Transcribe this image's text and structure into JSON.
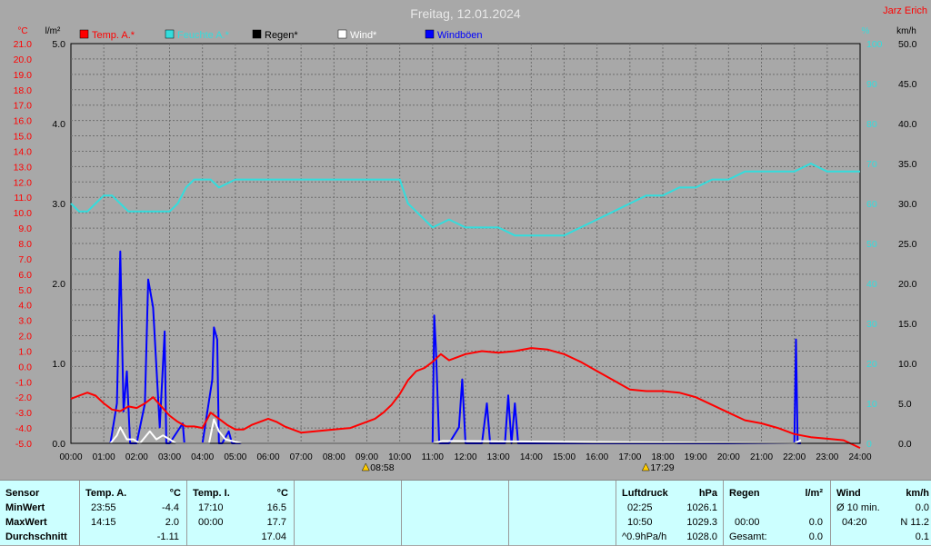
{
  "header": {
    "title": "Freitag, 12.01.2024",
    "author": "Jarz Erich"
  },
  "colors": {
    "temp": "#ff0000",
    "humidity": "#33dddd",
    "rain": "#000000",
    "wind": "#ffffff",
    "gust": "#0000ff",
    "grid": "#6e6e6e",
    "left_text": "#ff0000",
    "hum_text": "#33dddd"
  },
  "chart_data": {
    "type": "line",
    "title": "Freitag, 12.01.2024",
    "x_axis": {
      "start_hour": 0,
      "end_hour": 24,
      "tick_labels": [
        "00:00",
        "01:00",
        "02:00",
        "03:00",
        "04:00",
        "05:00",
        "06:00",
        "07:00",
        "08:00",
        "09:00",
        "10:00",
        "11:00",
        "12:00",
        "13:00",
        "14:00",
        "15:00",
        "16:00",
        "17:00",
        "18:00",
        "19:00",
        "20:00",
        "21:00",
        "22:00",
        "23:00",
        "24:00"
      ]
    },
    "axes": {
      "temp": {
        "unit": "°C",
        "min": -5.0,
        "max": 21.0,
        "ticks": [
          "21.0",
          "20.0",
          "19.0",
          "18.0",
          "17.0",
          "16.0",
          "15.0",
          "14.0",
          "13.0",
          "12.0",
          "11.0",
          "10.0",
          "9.0",
          "8.0",
          "7.0",
          "6.0",
          "5.0",
          "4.0",
          "3.0",
          "2.0",
          "1.0",
          "0.0",
          "-1.0",
          "-2.0",
          "-3.0",
          "-4.0",
          "-5.0"
        ]
      },
      "rain": {
        "unit": "l/m²",
        "min": 0,
        "max": 5,
        "ticks": [
          "5.0",
          "4.0",
          "3.0",
          "2.0",
          "1.0",
          "0.0"
        ]
      },
      "humidity": {
        "unit": "%",
        "min": 50,
        "max": 100,
        "ticks": [
          "100",
          "90",
          "80",
          "70",
          "60",
          "50",
          "40",
          "30",
          "20",
          "10",
          "0"
        ]
      },
      "wind": {
        "unit": "km/h",
        "min": 0,
        "max": 50,
        "ticks": [
          "50.0",
          "45.0",
          "40.0",
          "35.0",
          "30.0",
          "25.0",
          "20.0",
          "15.0",
          "10.0",
          "5.0",
          "0.0"
        ]
      }
    },
    "legend": {
      "placement": "top",
      "items": [
        {
          "label": "Temp. A.*",
          "color": "#ff0000"
        },
        {
          "label": "Feuchte A.*",
          "color": "#33dddd"
        },
        {
          "label": "Regen*",
          "color": "#000000"
        },
        {
          "label": "Wind*",
          "color": "#ffffff"
        },
        {
          "label": "Windböen",
          "color": "#0000ff"
        }
      ]
    },
    "sun": {
      "sunrise": "08:58",
      "sunset": "17:29"
    },
    "series": [
      {
        "name": "Temp. A.*",
        "axis": "temp",
        "x": [
          0,
          0.25,
          0.5,
          0.75,
          1,
          1.25,
          1.5,
          1.75,
          2,
          2.25,
          2.5,
          2.75,
          3,
          3.25,
          3.5,
          3.75,
          4,
          4.25,
          4.5,
          4.75,
          5,
          5.25,
          5.5,
          5.75,
          6,
          6.25,
          6.5,
          6.75,
          7,
          7.5,
          8,
          8.5,
          9,
          9.25,
          9.5,
          9.75,
          10,
          10.25,
          10.5,
          10.75,
          11,
          11.25,
          11.5,
          11.75,
          12,
          12.5,
          13,
          13.5,
          14,
          14.5,
          15,
          15.5,
          16,
          16.5,
          17,
          17.5,
          18,
          18.5,
          19,
          19.5,
          20,
          20.5,
          21,
          21.5,
          22,
          22.5,
          23,
          23.5,
          24
        ],
        "values": [
          -2.1,
          -1.9,
          -1.7,
          -1.9,
          -2.4,
          -2.8,
          -2.9,
          -2.6,
          -2.7,
          -2.4,
          -2.0,
          -2.6,
          -3.2,
          -3.6,
          -3.9,
          -3.9,
          -4.0,
          -3.0,
          -3.4,
          -3.8,
          -4.1,
          -4.1,
          -3.8,
          -3.6,
          -3.4,
          -3.6,
          -3.9,
          -4.1,
          -4.3,
          -4.2,
          -4.1,
          -4.0,
          -3.6,
          -3.4,
          -3.0,
          -2.5,
          -1.8,
          -0.9,
          -0.3,
          -0.1,
          0.3,
          0.8,
          0.4,
          0.6,
          0.8,
          1.0,
          0.9,
          1.0,
          1.2,
          1.1,
          0.8,
          0.3,
          -0.3,
          -0.9,
          -1.5,
          -1.6,
          -1.6,
          -1.7,
          -2.0,
          -2.5,
          -3.0,
          -3.5,
          -3.7,
          -4.0,
          -4.4,
          -4.6,
          -4.7,
          -4.8,
          -5.3
        ]
      },
      {
        "name": "Feuchte A.*",
        "axis": "humidity",
        "x": [
          0,
          0.25,
          0.5,
          0.75,
          1,
          1.25,
          1.5,
          1.75,
          2,
          2.5,
          3,
          3.25,
          3.5,
          3.75,
          4,
          4.25,
          4.5,
          5,
          5.5,
          6,
          6.5,
          7,
          7.5,
          8,
          8.5,
          9,
          9.5,
          10,
          10.25,
          10.5,
          10.75,
          11,
          11.5,
          12,
          12.5,
          13,
          13.5,
          14,
          14.5,
          15,
          15.5,
          16,
          16.5,
          17,
          17.5,
          18,
          18.5,
          19,
          19.5,
          20,
          20.5,
          21,
          21.5,
          22,
          22.5,
          23,
          23.5,
          24
        ],
        "values": [
          80,
          79,
          79,
          80,
          81,
          81,
          80,
          79,
          79,
          79,
          79,
          80,
          82,
          83,
          83,
          83,
          82,
          83,
          83,
          83,
          83,
          83,
          83,
          83,
          83,
          83,
          83,
          83,
          80,
          79,
          78,
          77,
          78,
          77,
          77,
          77,
          76,
          76,
          76,
          76,
          77,
          78,
          79,
          80,
          81,
          81,
          82,
          82,
          83,
          83,
          84,
          84,
          84,
          84,
          85,
          84,
          84,
          84
        ],
        "points_hint": "humidity shown on percent axis"
      },
      {
        "name": "Windböen",
        "axis": "wind",
        "x": [
          1.2,
          1.4,
          1.5,
          1.6,
          1.7,
          1.8,
          2.0,
          2.25,
          2.35,
          2.5,
          2.7,
          2.85,
          2.9,
          3.0,
          3.4,
          3.45,
          4.0,
          4.3,
          4.35,
          4.45,
          4.5,
          4.6,
          4.8,
          4.9,
          5.0,
          11.0,
          11.05,
          11.1,
          11.2,
          11.5,
          11.8,
          11.9,
          12.0,
          12.1,
          12.5,
          12.65,
          12.75,
          13.2,
          13.3,
          13.4,
          13.5,
          13.6,
          22.0,
          22.05,
          22.1,
          22.2
        ],
        "values": [
          0,
          5.0,
          24.0,
          4.0,
          9.0,
          0,
          0,
          5.0,
          20.5,
          17.0,
          2.0,
          14.0,
          0,
          0,
          2.5,
          0,
          0,
          8.0,
          14.5,
          13.0,
          0,
          0,
          1.5,
          0,
          0,
          0,
          16.0,
          12.0,
          0,
          0,
          2.0,
          8.0,
          0,
          0,
          0,
          5.0,
          0,
          0,
          6.0,
          0,
          5.0,
          0,
          0,
          13.0,
          0,
          0
        ]
      },
      {
        "name": "Wind*",
        "axis": "wind",
        "x": [
          1.2,
          1.4,
          1.5,
          1.7,
          1.9,
          2.1,
          2.4,
          2.6,
          2.8,
          3.0,
          3.2,
          4.2,
          4.35,
          4.5,
          4.7,
          4.9,
          5.2,
          11.0,
          11.3,
          22.0,
          22.2
        ],
        "values": [
          0,
          1.0,
          2.0,
          0.5,
          0.5,
          0,
          1.5,
          0.5,
          1.0,
          0.5,
          0,
          0,
          3.0,
          1.5,
          0.5,
          0.3,
          0,
          0,
          0.3,
          0,
          0.4
        ]
      },
      {
        "name": "Regen*",
        "axis": "rain",
        "x": [
          0,
          24
        ],
        "values": [
          0,
          0
        ]
      }
    ]
  },
  "table": {
    "sensor": {
      "header": "Sensor",
      "rows": [
        "MinWert",
        "MaxWert",
        "Durchschnitt"
      ]
    },
    "temp_a": {
      "header": "Temp. A.",
      "unit": "°C",
      "times": [
        "23:55",
        "14:15",
        ""
      ],
      "values": [
        "-4.4",
        "2.0",
        "-1.11"
      ]
    },
    "temp_i": {
      "header": "Temp. I.",
      "unit": "°C",
      "times": [
        "17:10",
        "00:00",
        ""
      ],
      "values": [
        "16.5",
        "17.7",
        "17.04"
      ]
    },
    "pressure": {
      "header": "Luftdruck",
      "unit": "hPa",
      "times": [
        "02:25",
        "10:50",
        "^0.9hPa/h"
      ],
      "values": [
        "1026.1",
        "1029.3",
        "1028.0"
      ]
    },
    "rain": {
      "header": "Regen",
      "unit": "l/m²",
      "times": [
        "",
        "00:00",
        "Gesamt:"
      ],
      "values": [
        "",
        "0.0",
        "0.0"
      ]
    },
    "wind": {
      "header": "Wind",
      "unit": "km/h",
      "times": [
        "Ø 10 min.",
        "04:20",
        ""
      ],
      "values": [
        "0.0",
        "N 11.2",
        "0.1"
      ]
    }
  }
}
